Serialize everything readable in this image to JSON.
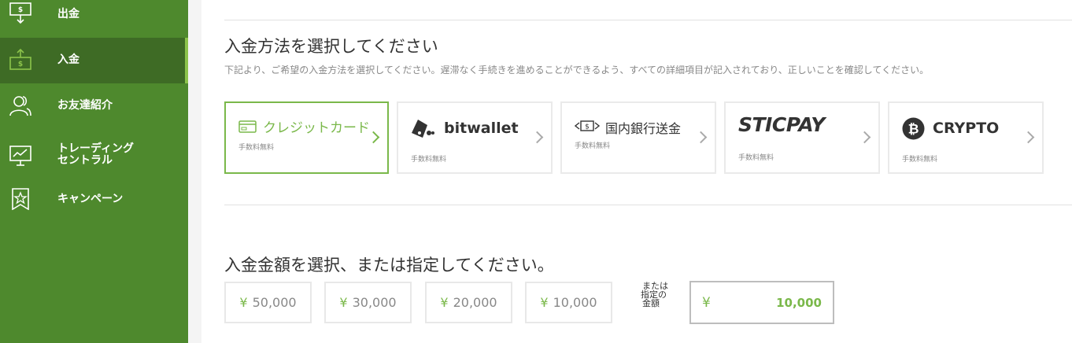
{
  "sidebar": {
    "items": [
      {
        "label": "出金",
        "icon": "withdraw-icon"
      },
      {
        "label": "入金",
        "icon": "deposit-icon",
        "active": true
      },
      {
        "label": "お友達紹介",
        "icon": "users-icon"
      },
      {
        "label": "トレーディング\nセントラル",
        "icon": "chart-monitor-icon"
      },
      {
        "label": "キャンペーン",
        "icon": "star-badge-icon"
      }
    ]
  },
  "method": {
    "title": "入金方法を選択してください",
    "description": "下記より、ご希望の入金方法を選択してください。遅滞なく手続きを進めることができるよう、すべての詳細項目が記入されており、正しいことを確認してください。",
    "cards": [
      {
        "name": "クレジットカード",
        "fee": "手数料無料",
        "selected": true,
        "icon": "credit-card-icon"
      },
      {
        "name": "bitwallet",
        "fee": "手数料無料",
        "icon": "bitwallet-logo-icon"
      },
      {
        "name": "国内銀行送金",
        "fee": "手数料無料",
        "icon": "bank-transfer-icon"
      },
      {
        "name": "STICPAY",
        "fee": "手数料無料",
        "icon": "sticpay-logo"
      },
      {
        "name": "CRYPTO",
        "fee": "手数料無料",
        "icon": "bitcoin-icon"
      }
    ]
  },
  "amount": {
    "title": "入金金額を選択、または指定してください。",
    "currency_symbol": "¥",
    "presets": [
      "50,000",
      "30,000",
      "20,000",
      "10,000"
    ],
    "custom_label_lines": [
      "または",
      "指定の",
      "金額"
    ],
    "custom_value": "10,000"
  },
  "colors": {
    "sidebar_bg": "#4e892d",
    "sidebar_active": "#3e6b25",
    "accent": "#7ab84a"
  }
}
